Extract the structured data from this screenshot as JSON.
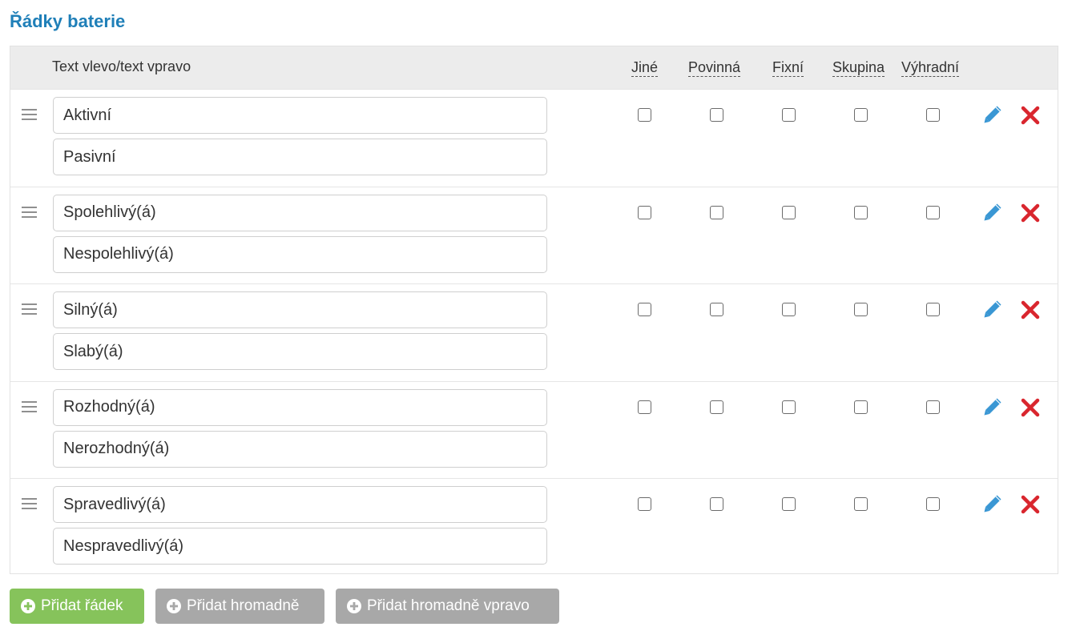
{
  "title": "Řádky baterie",
  "header": {
    "text_column": "Text vlevo/text vpravo",
    "columns": [
      "Jiné",
      "Povinná",
      "Fixní",
      "Skupina",
      "Výhradní"
    ]
  },
  "rows": [
    {
      "left": "Aktivní",
      "right": "Pasivní",
      "checks": [
        false,
        false,
        false,
        false,
        false
      ]
    },
    {
      "left": "Spolehlivý(á)",
      "right": "Nespolehlivý(á)",
      "checks": [
        false,
        false,
        false,
        false,
        false
      ]
    },
    {
      "left": "Silný(á)",
      "right": "Slabý(á)",
      "checks": [
        false,
        false,
        false,
        false,
        false
      ]
    },
    {
      "left": "Rozhodný(á)",
      "right": "Nerozhodný(á)",
      "checks": [
        false,
        false,
        false,
        false,
        false
      ]
    },
    {
      "left": "Spravedlivý(á)",
      "right": "Nespravedlivý(á)",
      "checks": [
        false,
        false,
        false,
        false,
        false
      ]
    }
  ],
  "icons": {
    "drag": "drag-handle-icon",
    "edit": "pencil-icon",
    "delete": "close-icon",
    "add": "plus-circle-icon"
  },
  "buttons": {
    "add_row": "Přidat řádek",
    "add_bulk": "Přidat hromadně",
    "add_bulk_right": "Přidat hromadně vpravo"
  },
  "colors": {
    "title": "#1f7fb8",
    "edit_icon": "#3a97d4",
    "delete_icon": "#d9262e",
    "primary_button": "#86c35b",
    "secondary_button": "#a8a8a8"
  }
}
